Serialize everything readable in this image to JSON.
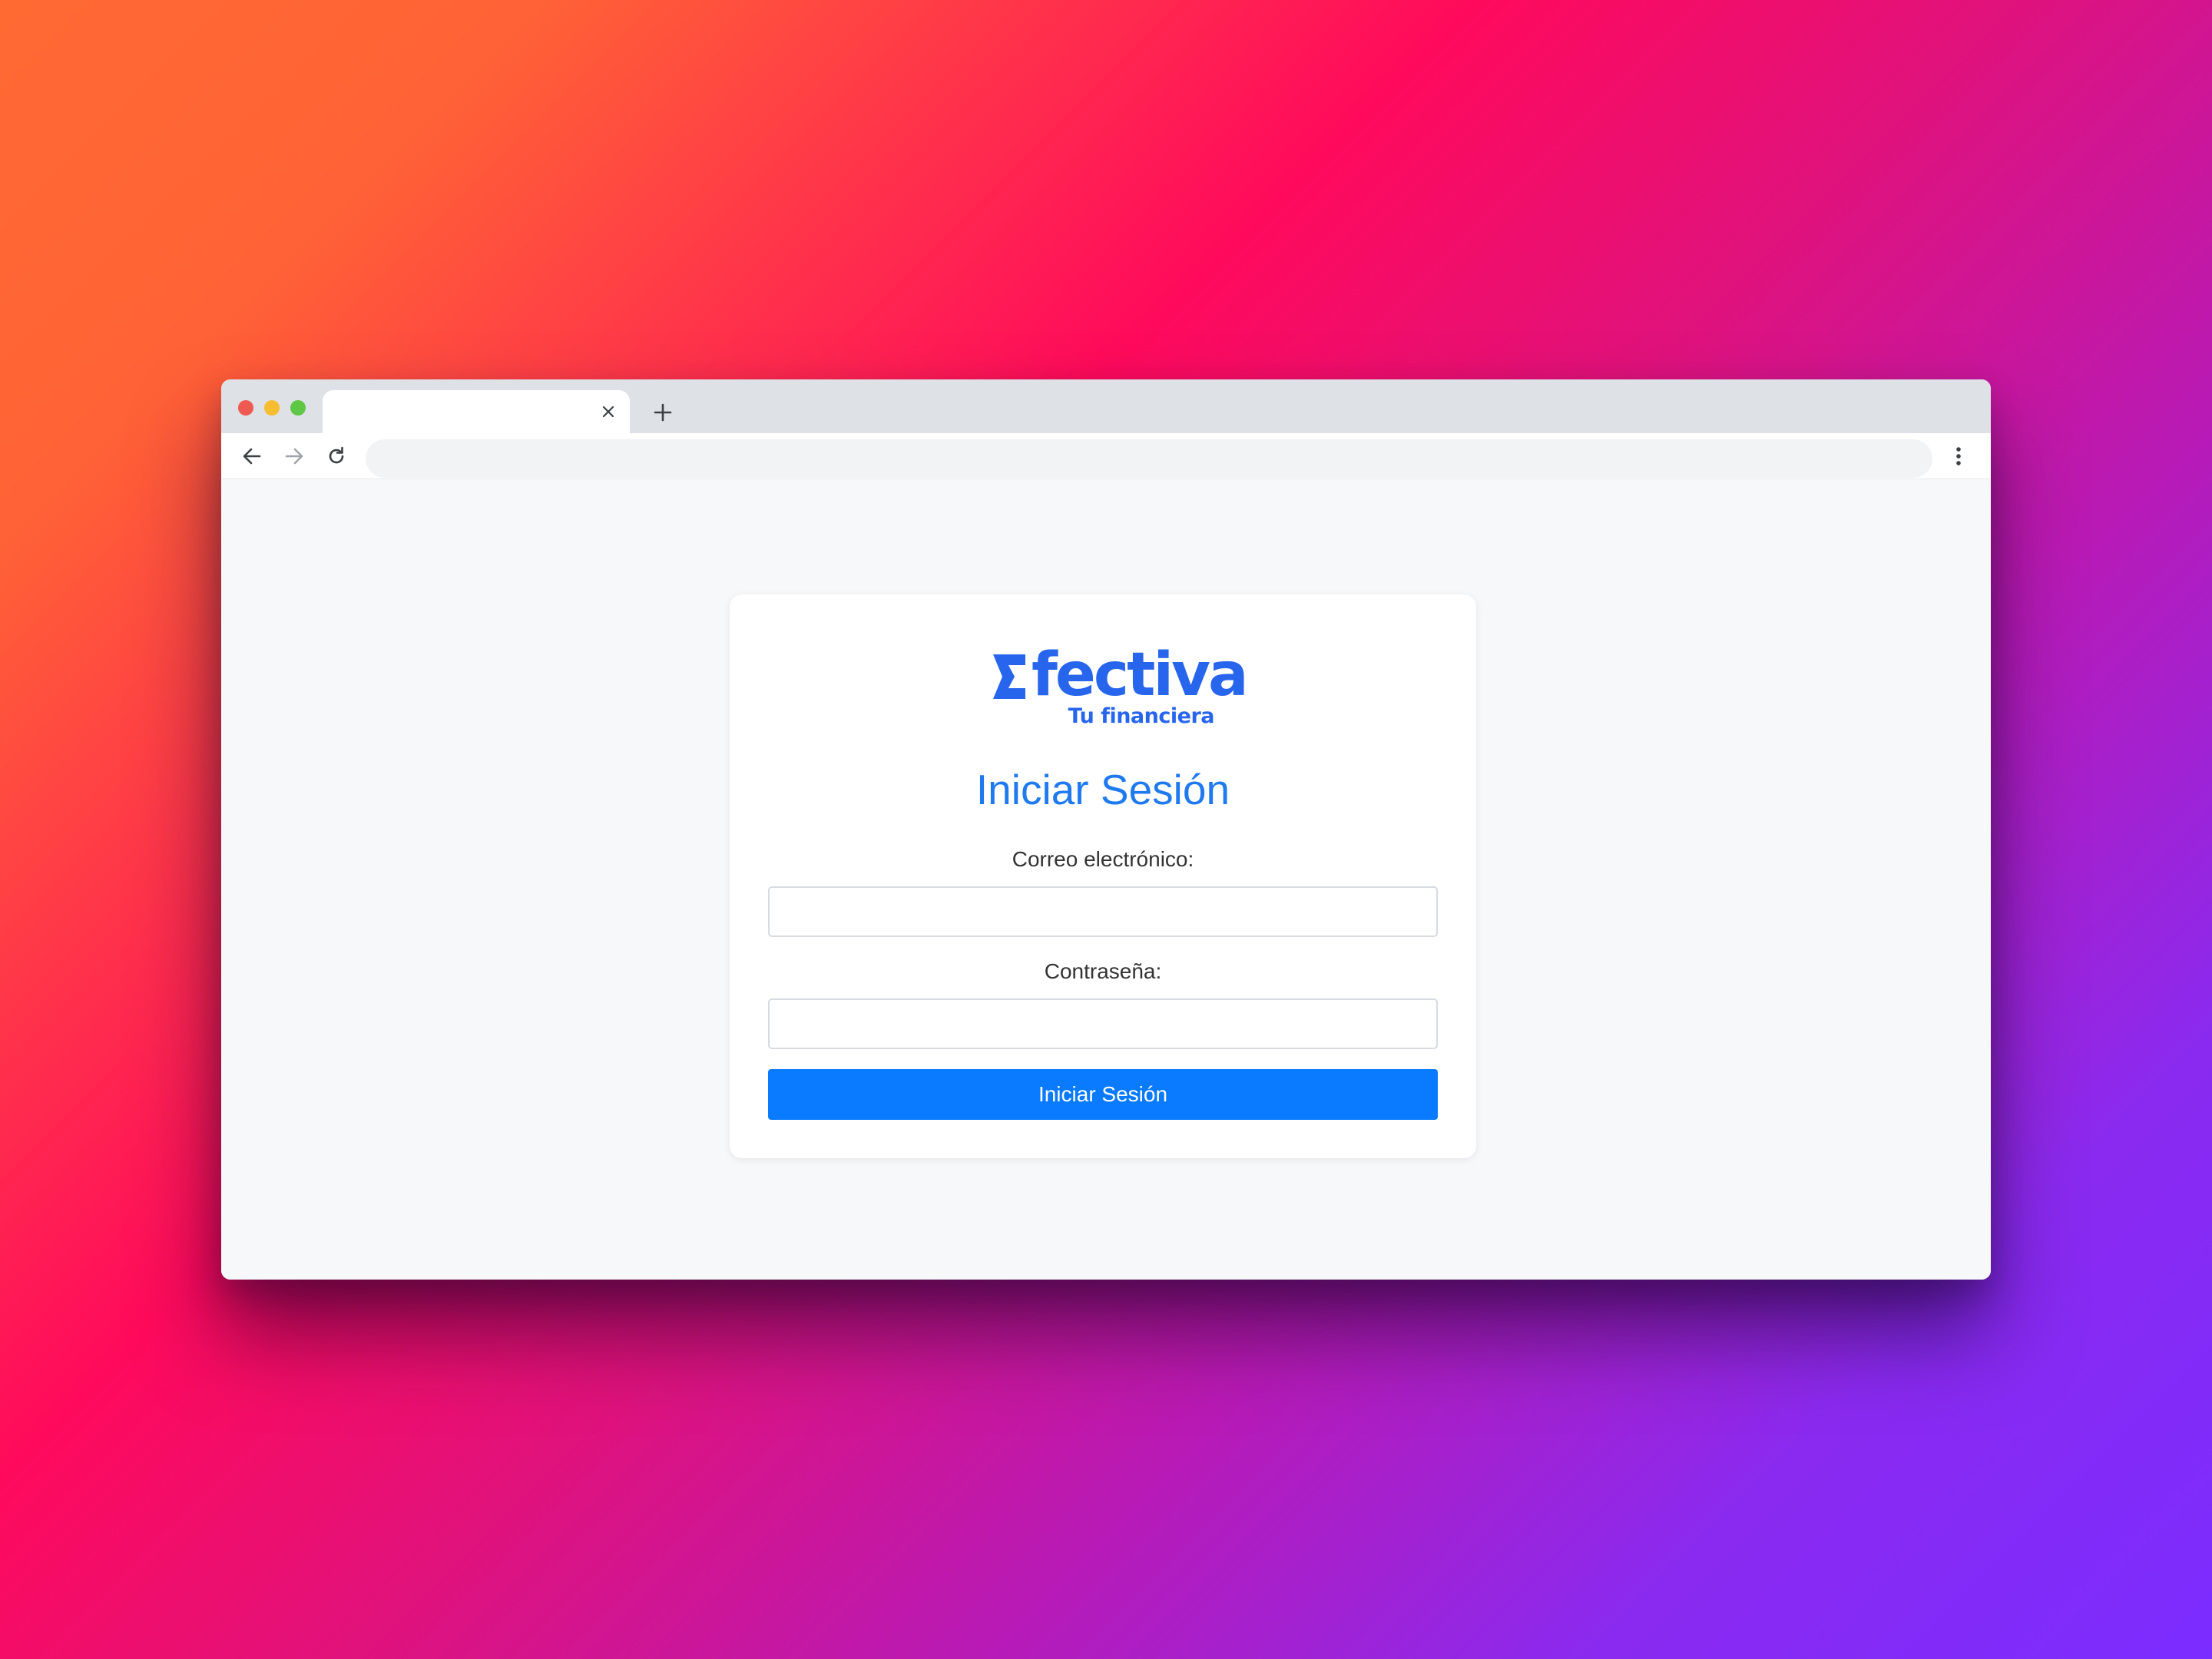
{
  "browser": {
    "tab_title": "",
    "address": "",
    "icons": {
      "close_tab": "close-icon",
      "new_tab": "plus-icon",
      "back": "arrow-left-icon",
      "forward": "arrow-right-icon",
      "reload": "reload-icon",
      "menu": "kebab-menu-icon"
    }
  },
  "login": {
    "logo_text": "Efectiva",
    "logo_tagline": "Tu financiera",
    "heading": "Iniciar Sesión",
    "email_label": "Correo electrónico:",
    "email_value": "",
    "password_label": "Contraseña:",
    "password_value": "",
    "submit_label": "Iniciar Sesión"
  },
  "colors": {
    "brand": "#2766ec",
    "primary_button": "#0a7bff",
    "heading": "#1f7af0",
    "page_background": "#f7f8fa"
  }
}
